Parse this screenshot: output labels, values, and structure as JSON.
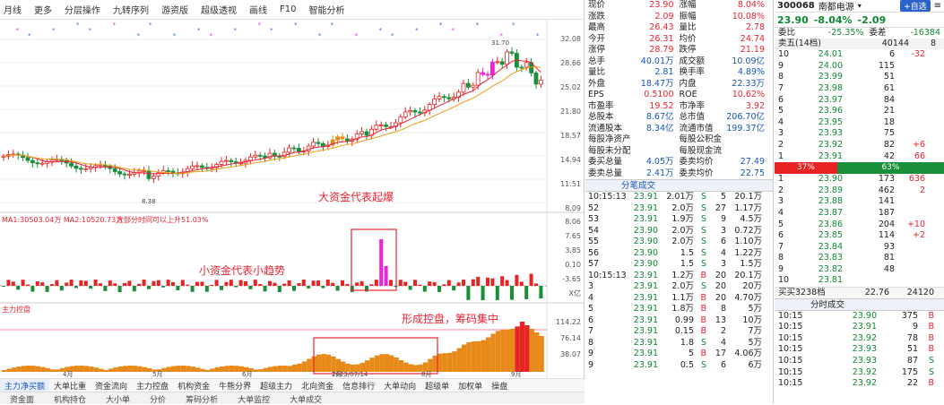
{
  "toolbar": {
    "items": [
      "月线",
      "更多",
      "分层操作",
      "九转序列",
      "游资版",
      "超级透视",
      "画线",
      "F10",
      "智能分析"
    ]
  },
  "price_axis": [
    "32.08",
    "28.66",
    "25.02",
    "21.80",
    "18.57",
    "14.94",
    "11.51",
    "8.09"
  ],
  "chart_labels": {
    "high": "31.70",
    "low": "8.38",
    "date_hint": "2023/07/14"
  },
  "annotations": {
    "a1": "大资金代表起爆",
    "a2": "小资金代表小趋势",
    "a3": "形成控盘，筹码集中"
  },
  "ind1": {
    "title": "MA1:30503.04万  MA2:10520.73万",
    "cur": "大部分时间可以上升51.03%",
    "lbls": [
      "8.06",
      "7.65",
      "3.85",
      "0.10",
      "-3.65",
      "X亿"
    ]
  },
  "ind2": {
    "title": "主力控盘",
    "lbls": [
      "114.22",
      "76.14",
      "38.07"
    ]
  },
  "months": [
    "4月",
    "5月",
    "6月",
    "7月",
    "8月",
    "9月"
  ],
  "bottom_tabs": [
    "主力净买额",
    "大单比重",
    "资金流向",
    "主力控盘",
    "机构资金",
    "牛熊分界",
    "超级主力",
    "北向资金",
    "信息排行",
    "大单动向",
    "超级单",
    "加权单",
    "操盘"
  ],
  "bottom_tabs2": [
    "资金面",
    "机构持仓",
    "大小单",
    "分价",
    "筹码分析",
    "大单监控",
    "大单成交"
  ],
  "quote": {
    "rows": [
      [
        "现价",
        "23.90",
        "涨幅",
        "8.04%"
      ],
      [
        "涨跌",
        "2.09",
        "振幅",
        "10.08%"
      ],
      [
        "最高",
        "26.43",
        "量比",
        "2.78"
      ],
      [
        "今开",
        "26.31",
        "均价",
        "24.74"
      ],
      [
        "涨停",
        "28.79",
        "跌停",
        "21.19"
      ],
      [
        "总手",
        "40.01万",
        "成交额",
        "10.09亿"
      ],
      [
        "量比",
        "2.81",
        "换手率",
        "4.89%"
      ],
      [
        "外盘",
        "18.47万",
        "内盘",
        "22.33万"
      ],
      [
        "EPS",
        "0.5100",
        "ROE",
        "10.62%"
      ],
      [
        "市盈率",
        "19.52",
        "市净率",
        "3.92"
      ],
      [
        "总股本",
        "8.67亿",
        "总市值",
        "206.70亿"
      ],
      [
        "流通股本",
        "8.34亿",
        "流通市值",
        "199.37亿"
      ],
      [
        "每股净资产",
        "",
        "每股公积金",
        ""
      ],
      [
        "每股未分配",
        "",
        "每股现金流",
        ""
      ],
      [
        "委买总量",
        "4.05万",
        "委卖均价",
        "27.49"
      ],
      [
        "委卖总量",
        "2.41万",
        "委卖均价",
        "22.75"
      ]
    ],
    "trade_hdr": "分笔成交",
    "trades": [
      [
        "10:15:13",
        "23.91",
        "2.01万",
        "S",
        "5",
        "20.1万"
      ],
      [
        "52",
        "23.91",
        "2.0万",
        "S",
        "27",
        "1.17万"
      ],
      [
        "53",
        "23.91",
        "1.9万",
        "S",
        "9",
        "4.5万"
      ],
      [
        "54",
        "23.90",
        "2.0万",
        "S",
        "3",
        "0.72万"
      ],
      [
        "55",
        "23.90",
        "2.0万",
        "S",
        "6",
        "1.10万"
      ],
      [
        "56",
        "23.90",
        "1.5",
        "S",
        "4",
        "1.22万"
      ],
      [
        "57",
        "23.90",
        "1.5",
        "S",
        "3",
        "1.5万"
      ],
      [
        "10:15:13",
        "23.91",
        "1.2万",
        "B",
        "20",
        "20.1万"
      ],
      [
        "3",
        "23.91",
        "2.0万",
        "S",
        "20",
        "20万"
      ],
      [
        "4",
        "23.91",
        "1.1万",
        "B",
        "20",
        "4.70万"
      ],
      [
        "5",
        "23.91",
        "1.8万",
        "B",
        "8",
        "5万"
      ],
      [
        "6",
        "23.91",
        "0.99",
        "B",
        "13",
        "10万"
      ],
      [
        "7",
        "23.91",
        "0.15",
        "B",
        "2",
        "7万"
      ],
      [
        "8",
        "23.91",
        "1.8",
        "S",
        "4",
        "5万"
      ],
      [
        "9",
        "23.91",
        "5",
        "B",
        "17",
        "4.06万"
      ],
      [
        "9",
        "23.91",
        "0.5",
        "S",
        "6",
        "6万"
      ]
    ]
  },
  "book": {
    "code": "300068",
    "name": "南都电源",
    "btn": "+自选",
    "price": "23.90",
    "chg": "-8.04%",
    "chg2": "-2.09",
    "hdr": [
      "委比",
      "-25.35%",
      "委差",
      "-16384"
    ],
    "hdr2": [
      "卖五(14档)",
      "",
      "40144",
      "8"
    ],
    "asks": [
      [
        "10",
        "24.01",
        "6",
        "-32"
      ],
      [
        "9",
        "24.00",
        "115",
        ""
      ],
      [
        "8",
        "23.99",
        "51",
        ""
      ],
      [
        "7",
        "23.98",
        "61",
        ""
      ],
      [
        "6",
        "23.97",
        "84",
        ""
      ],
      [
        "5",
        "23.96",
        "21",
        ""
      ],
      [
        "4",
        "23.95",
        "18",
        ""
      ],
      [
        "3",
        "23.93",
        "75",
        ""
      ],
      [
        "2",
        "23.92",
        "82",
        "+6"
      ],
      [
        "1",
        "23.91",
        "42",
        "66"
      ]
    ],
    "bar": [
      "37%",
      "63%"
    ],
    "bids": [
      [
        "1",
        "23.90",
        "173",
        "636"
      ],
      [
        "2",
        "23.89",
        "462",
        "2"
      ],
      [
        "3",
        "23.88",
        "141",
        ""
      ],
      [
        "4",
        "23.87",
        "187",
        ""
      ],
      [
        "5",
        "23.86",
        "204",
        "+10"
      ],
      [
        "6",
        "23.85",
        "114",
        "+2"
      ],
      [
        "7",
        "23.84",
        "93",
        ""
      ],
      [
        "8",
        "23.83",
        "81",
        ""
      ],
      [
        "9",
        "23.82",
        "48",
        ""
      ],
      [
        "10",
        "23.81",
        "",
        ""
      ]
    ],
    "footer": [
      "买买3238档",
      "22.76",
      "24120"
    ],
    "trade_hdr": "分时成交",
    "trades": [
      [
        "10:15",
        "23.90",
        "375",
        "B"
      ],
      [
        "10:15",
        "23.91",
        "9",
        "B"
      ],
      [
        "10:15",
        "23.92",
        "78",
        "B"
      ],
      [
        "10:15",
        "23.93",
        "51",
        "B"
      ],
      [
        "10:15",
        "23.93",
        "87",
        "S"
      ],
      [
        "10:15",
        "23.92",
        "175",
        "S"
      ],
      [
        "10:15",
        "23.92",
        "22",
        "B"
      ]
    ]
  },
  "colors": {
    "up": "#e82323",
    "down": "#1a8f3a",
    "orange": "#e88a1a",
    "magenta": "#ee22dd",
    "blue": "#1a56b8"
  }
}
